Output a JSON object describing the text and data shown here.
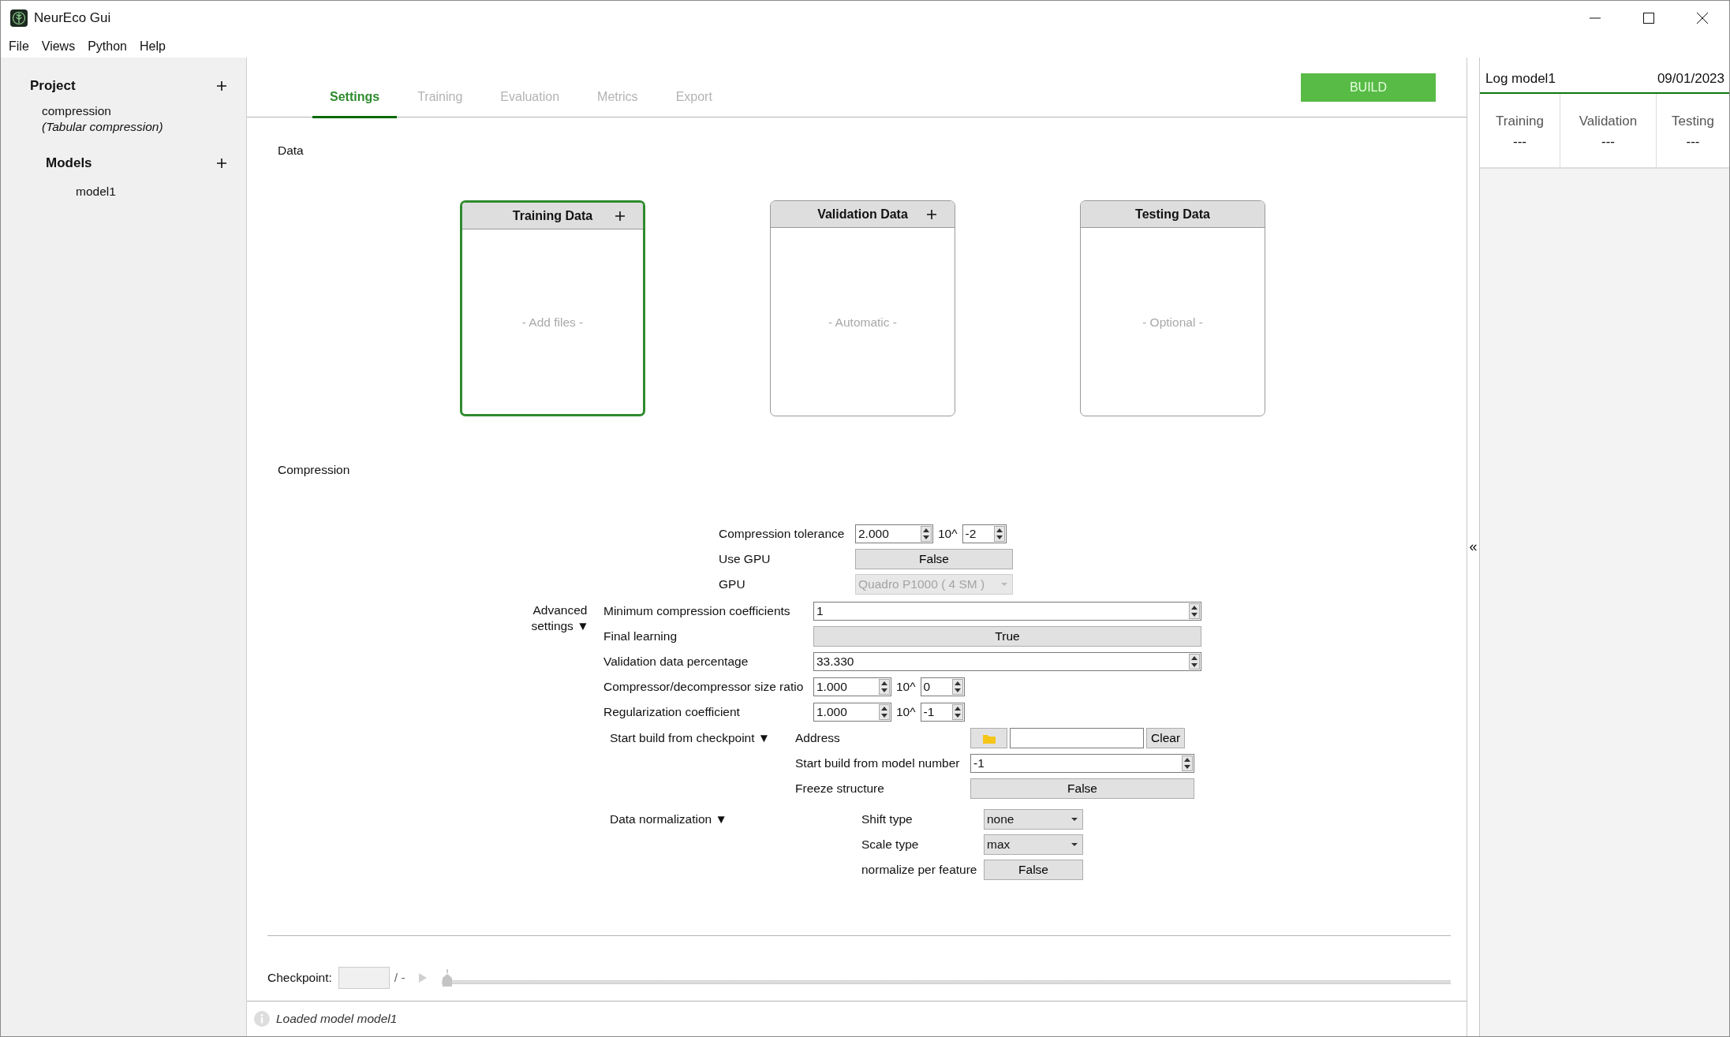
{
  "window": {
    "title": "NeurEco Gui"
  },
  "menu": [
    "File",
    "Views",
    "Python",
    "Help"
  ],
  "sidebar": {
    "project_label": "Project",
    "project_name": "compression",
    "project_type": "(Tabular compression)",
    "models_label": "Models",
    "models": [
      {
        "name": "model1"
      }
    ]
  },
  "tabs": [
    {
      "label": "Settings",
      "selected": true
    },
    {
      "label": "Training",
      "selected": false
    },
    {
      "label": "Evaluation",
      "selected": false
    },
    {
      "label": "Metrics",
      "selected": false
    },
    {
      "label": "Export",
      "selected": false
    }
  ],
  "build_button": "BUILD",
  "data": {
    "title": "Data",
    "cards": [
      {
        "title": "Training Data",
        "addable": true,
        "hint": "- Add files -",
        "selected": true
      },
      {
        "title": "Validation Data",
        "addable": true,
        "hint": "- Automatic -",
        "selected": false
      },
      {
        "title": "Testing Data",
        "addable": false,
        "hint": "- Optional -",
        "selected": false
      }
    ]
  },
  "compression": {
    "title": "Compression",
    "basic": [
      {
        "kind": "spin_exp",
        "label": "Compression tolerance",
        "value": "2.000",
        "exp_label": "10^",
        "exponent": "-2"
      },
      {
        "kind": "toggle",
        "label": "Use GPU",
        "value": "False"
      },
      {
        "kind": "select",
        "label": "GPU",
        "value": "Quadro P1000 ( 4 SM )",
        "disabled": true
      }
    ],
    "advanced": {
      "label": "Advanced settings ▼",
      "rows": [
        {
          "kind": "spin",
          "label": "Minimum compression coefficients",
          "value": "1"
        },
        {
          "kind": "toggle",
          "label": "Final learning",
          "value": "True"
        },
        {
          "kind": "spin",
          "label": "Validation data percentage",
          "value": "33.330"
        },
        {
          "kind": "spin_exp",
          "label": "Compressor/decompressor size ratio",
          "value": "1.000",
          "exp_label": "10^",
          "exponent": "0"
        },
        {
          "kind": "spin_exp",
          "label": "Regularization coefficient",
          "value": "1.000",
          "exp_label": "10^",
          "exponent": "-1"
        }
      ]
    },
    "checkpoint": {
      "label": "Start build from checkpoint ▼",
      "rows": [
        {
          "kind": "file",
          "label": "Address",
          "button": "Clear"
        },
        {
          "kind": "spin",
          "label": "Start build from model number",
          "value": "-1"
        },
        {
          "kind": "toggle",
          "label": "Freeze structure",
          "value": "False"
        }
      ]
    },
    "normalization": {
      "label": "Data normalization ▼",
      "rows": [
        {
          "kind": "select",
          "label": "Shift type",
          "value": "none",
          "disabled": false
        },
        {
          "kind": "select",
          "label": "Scale type",
          "value": "max",
          "disabled": false
        },
        {
          "kind": "toggle",
          "label": "normalize per feature",
          "value": "False"
        }
      ]
    }
  },
  "checkpoint_bar": {
    "label": "Checkpoint:",
    "separator": "/ -",
    "level": 0
  },
  "status_bar": {
    "message": "Loaded model model1"
  },
  "collapse_handle": "«",
  "log": {
    "title": "Log model1",
    "date": "09/01/2023",
    "columns": [
      {
        "label": "Training",
        "value": "---"
      },
      {
        "label": "Validation",
        "value": "---"
      },
      {
        "label": "Testing",
        "value": "---"
      }
    ]
  }
}
